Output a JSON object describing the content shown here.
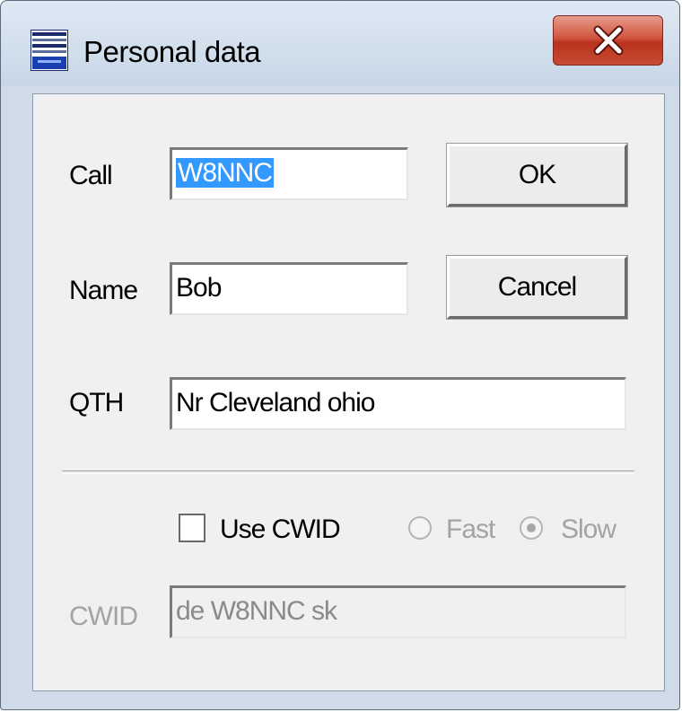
{
  "window": {
    "title": "Personal data"
  },
  "fields": {
    "call": {
      "label": "Call",
      "value": "W8NNC"
    },
    "name": {
      "label": "Name",
      "value": "Bob"
    },
    "qth": {
      "label": "QTH",
      "value": "Nr Cleveland  ohio"
    },
    "cwid": {
      "label": "CWID",
      "value": "de W8NNC sk"
    }
  },
  "buttons": {
    "ok": "OK",
    "cancel": "Cancel"
  },
  "options": {
    "use_cwid": {
      "label": "Use CWID",
      "checked": false
    },
    "speed": {
      "fast": "Fast",
      "slow": "Slow",
      "selected": "Slow"
    }
  },
  "colors": {
    "close_button": "#c84c36",
    "selection": "#3399ff",
    "disabled_text": "#a3a3a3"
  }
}
